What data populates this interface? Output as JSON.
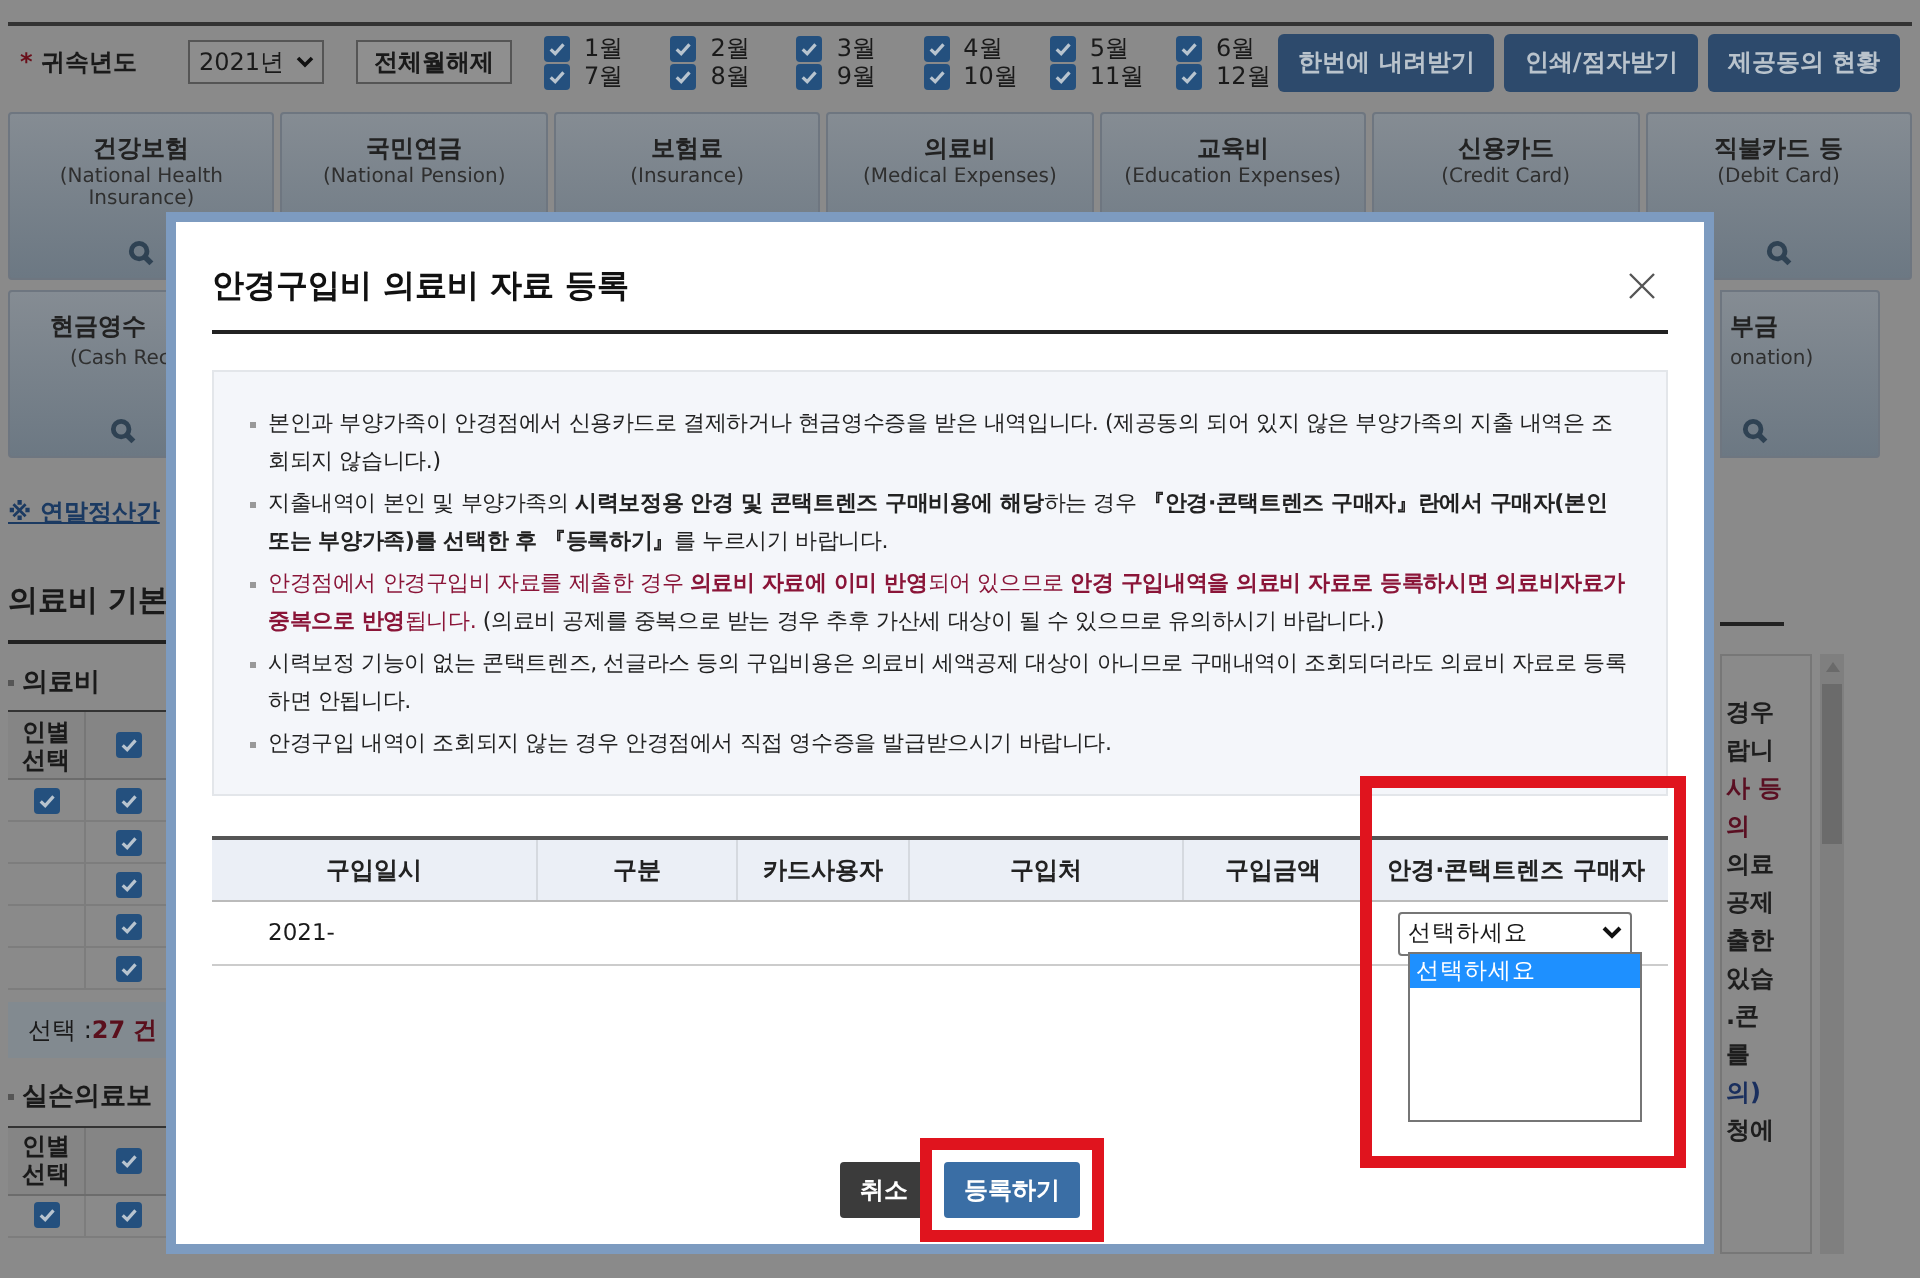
{
  "toolbar": {
    "required_mark": "*",
    "year_label": "귀속년도",
    "year": "2021년",
    "clear_all": "전체월해제",
    "months": [
      {
        "label": "1월",
        "checked": true
      },
      {
        "label": "2월",
        "checked": true
      },
      {
        "label": "3월",
        "checked": true
      },
      {
        "label": "4월",
        "checked": true
      },
      {
        "label": "5월",
        "checked": true
      },
      {
        "label": "6월",
        "checked": true
      },
      {
        "label": "7월",
        "checked": true
      },
      {
        "label": "8월",
        "checked": true
      },
      {
        "label": "9월",
        "checked": true
      },
      {
        "label": "10월",
        "checked": true
      },
      {
        "label": "11월",
        "checked": true
      },
      {
        "label": "12월",
        "checked": true
      }
    ],
    "buttons": [
      "한번에 내려받기",
      "인쇄/점자받기",
      "제공동의 현황"
    ]
  },
  "categories": [
    {
      "label": "건강보험",
      "sub": "(National Health Insurance)"
    },
    {
      "label": "국민연금",
      "sub": "(National Pension)"
    },
    {
      "label": "보험료",
      "sub": "(Insurance)"
    },
    {
      "label": "의료비",
      "sub": "(Medical Expenses)"
    },
    {
      "label": "교육비",
      "sub": "(Education Expenses)"
    },
    {
      "label": "신용카드",
      "sub": "(Credit Card)"
    },
    {
      "label": "직불카드 등",
      "sub": "(Debit Card)"
    }
  ],
  "categories_row2": [
    {
      "label": "현금영수",
      "sub": "(Cash Rec"
    },
    {
      "label": "부금",
      "sub": "onation)"
    }
  ],
  "left": {
    "link": "※ 연말정산간",
    "heading": "의료비 기본",
    "sections": [
      {
        "title": "의료비",
        "header": "인별 선택",
        "header_checked": true,
        "rows": [
          {
            "person_checked": true,
            "checked": true
          },
          {
            "checked": true
          },
          {
            "checked": true
          },
          {
            "checked": true
          },
          {
            "checked": true
          }
        ],
        "summary_label": "선택 : ",
        "summary_count": "27 건"
      },
      {
        "title": "실손의료보",
        "header": "인별 선택",
        "header_checked": true,
        "rows": [
          {
            "person_checked": true,
            "checked": true
          }
        ]
      }
    ]
  },
  "right_fragments": [
    {
      "text": "경우",
      "kind": "normal"
    },
    {
      "text": "랍니",
      "kind": "normal"
    },
    {
      "text": "사 등",
      "kind": "warning"
    },
    {
      "text": "의",
      "kind": "warning"
    },
    {
      "text": "의료",
      "kind": "normal"
    },
    {
      "text": "공제",
      "kind": "normal"
    },
    {
      "text": "출한",
      "kind": "normal"
    },
    {
      "text": "있습",
      "kind": "normal"
    },
    {
      "text": ".콘",
      "kind": "normal"
    },
    {
      "text": "를",
      "kind": "normal"
    },
    {
      "text": "의)",
      "kind": "link"
    },
    {
      "text": "청에",
      "kind": "normal"
    }
  ],
  "modal": {
    "title": "안경구입비 의료비 자료 등록",
    "notes": [
      {
        "kind": "normal",
        "text": "본인과 부양가족이 안경점에서 신용카드로 결제하거나 현금영수증을 받은 내역입니다. (제공동의 되어 있지 않은 부양가족의 지출 내역은 조회되지 않습니다.)"
      },
      {
        "kind": "normal",
        "text": "지출내역이 본인 및 부양가족의 **시력보정용 안경 및 콘택트렌즈 구매비용에 해당**하는 경우 **『안경·콘택트렌즈 구매자』란에서 구매자(본인 또는 부양가족)를 선택한 후 『등록하기』**를 누르시기 바랍니다."
      },
      {
        "kind": "warning",
        "text": "안경점에서 안경구입비 자료를 제출한 경우 **의료비 자료에 이미 반영**되어 있으므로 **안경 구입내역을 의료비 자료로 등록하시면 의료비자료가 중복으로 반영**됩니다.",
        "tail": " (의료비 공제를 중복으로 받는 경우 추후 가산세 대상이 될 수 있으므로 유의하시기 바랍니다.)"
      },
      {
        "kind": "normal",
        "text": "시력보정 기능이 없는 콘택트렌즈, 선글라스 등의 구입비용은 의료비 세액공제 대상이 아니므로 구매내역이 조회되더라도 의료비 자료로 등록하면 안됩니다."
      },
      {
        "kind": "normal",
        "text": "안경구입 내역이 조회되지 않는 경우 안경점에서 직접 영수증을 발급받으시기 바랍니다."
      }
    ],
    "columns": [
      "구입일시",
      "구분",
      "카드사용자",
      "구입처",
      "구입금액",
      "안경·콘택트렌즈 구매자"
    ],
    "rows": [
      {
        "date": "2021-",
        "buyer": "선택하세요"
      }
    ],
    "dropdown_options": [
      {
        "label": "선택하세요",
        "selected": true
      }
    ],
    "buttons": {
      "cancel": "취소",
      "submit": "등록하기"
    }
  }
}
